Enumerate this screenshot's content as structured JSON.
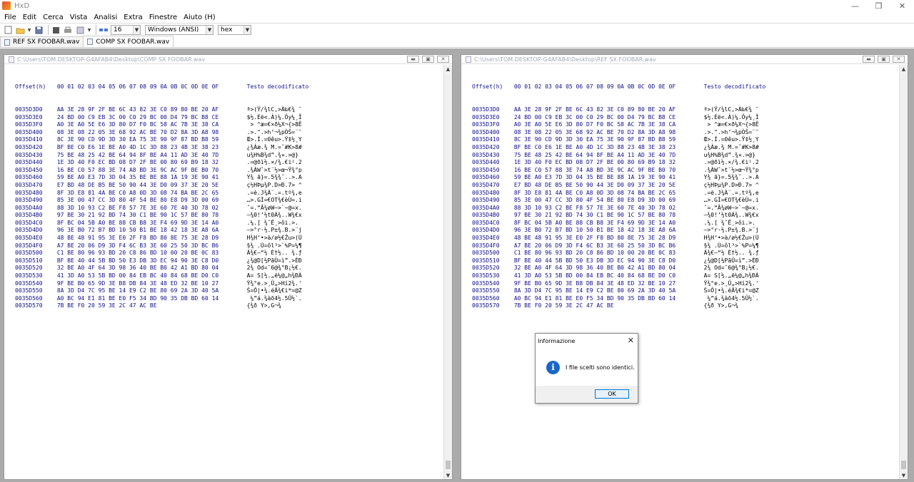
{
  "app": {
    "title": "HxD"
  },
  "window_controls": {
    "minimize": "—",
    "restore": "❐",
    "close": "✕"
  },
  "menu": [
    "File",
    "Edit",
    "Cerca",
    "Vista",
    "Analisi",
    "Extra",
    "Finestre",
    "Aiuto (H)"
  ],
  "toolbar": {
    "bytes_per_row": "16",
    "charset": "Windows (ANSI)",
    "offset_base": "hex"
  },
  "tabs": [
    {
      "label": "REF SX FOOBAR.wav",
      "active": false
    },
    {
      "label": "COMP SX FOOBAR.wav",
      "active": true
    }
  ],
  "panels": [
    {
      "title": "C:\\Users\\TOM.DESKTOP-G4AFAB4\\Desktop\\COMP SX FOOBAR.wav"
    },
    {
      "title": "C:\\Users\\TOM.DESKTOP-G4AFAB4\\Desktop\\REF SX FOOBAR.wav"
    }
  ],
  "hex_header": {
    "offset": "Offset(h)",
    "columns": "00 01 02 03 04 05 06 07 08 09 0A 0B 0C 0D 0E 0F",
    "text": "Testo decodificato"
  },
  "hex_rows": [
    {
      "offset": "0035D3D0",
      "bytes": "AA 3E 28 9F 2F BE 6C 43 82 3E C0 89 80 BE 20 AF",
      "text": "ª>(Ÿ/¾lC‚>À‰€¾ ¯"
    },
    {
      "offset": "0035D3E0",
      "bytes": "24 BD 00 C9 EB 3C 00 C0 29 BC 00 D4 79 BC B8 CE",
      "text": "$½.Éë<.À)¼.Ôy¼¸Î"
    },
    {
      "offset": "0035D3F0",
      "bytes": "A0 3E A0 5E E6 3D 80 D7 F0 BC 58 AC 7B 3E 38 CA",
      "text": " > ^æ=€×ð¼X¬{>8Ê"
    },
    {
      "offset": "0035D400",
      "bytes": "08 3E 08 22 05 3E 68 92 AC BE 70 D2 8A 3D A8 98",
      "text": ".>.\".>h’¬¾pÒŠ=¨˜"
    },
    {
      "offset": "0035D410",
      "bytes": "8C 3E 90 CD 9D 3D 30 EA 75 3E 90 9F 87 BD B8 59",
      "text": "Œ>.Í.=0êu>.Ÿ‡½¸Y"
    },
    {
      "offset": "0035D420",
      "bytes": "BF BE C0 E6 1E BE A0 4D 1C 3D 88 23 4B 3E 38 23",
      "text": "¿¾Àæ.¾ M.=ˆ#K>8#"
    },
    {
      "offset": "0035D430",
      "bytes": "75 BE 48 25 42 BE 64 94 8F BE A4 11 AD 3E 40 7D",
      "text": "u¾H%B¾d”.¾¤.­>@}"
    },
    {
      "offset": "0035D440",
      "bytes": "1E 3D 40 F0 EC BD 08 D7 2F BE 00 80 69 B9 18 32",
      "text": ".=@ðì½.×/¾.€i¹.2"
    },
    {
      "offset": "0035D450",
      "bytes": "16 BE C0 57 88 3E 74 A8 BD 3E 9C AC 9F BE B0 70",
      "text": ".¾ÀWˆ>t¨½>œ¬Ÿ¾°p"
    },
    {
      "offset": "0035D460",
      "bytes": "59 BE A0 E3 7D 3D 04 35 BE BE 88 1A 19 3E 90 41",
      "text": "Y¾ ã}=.5¾¾ˆ..>.A"
    },
    {
      "offset": "0035D470",
      "bytes": "E7 BD 48 DE B5 BE 50 90 44 3E D0 09 37 3E 20 5E",
      "text": "ç½HÞµ¾P.D>Ð.7> ^"
    },
    {
      "offset": "0035D480",
      "bytes": "8F 3D E8 81 4A BE C0 A8 0D 3D 08 74 BA BE 2C 65",
      "text": ".=è.J¾À¨.=.tº¾,e"
    },
    {
      "offset": "0035D490",
      "bytes": "85 3E 00 47 CC 3D 80 4F 54 BE 80 E8 D9 3D 00 69",
      "text": "…>.GÌ=€OT¾€èÙ=.i"
    },
    {
      "offset": "0035D4A0",
      "bytes": "88 3D 10 93 C2 BE F8 57 7E 3E 60 7E 40 3D 78 02",
      "text": "ˆ=.“Â¾øW~>`~@=x."
    },
    {
      "offset": "0035D4B0",
      "bytes": "97 BE 30 21 92 BD 74 30 C1 BE 90 1C 57 BE 80 78",
      "text": "—¾0!’½t0Á¾..W¾€x"
    },
    {
      "offset": "0035D4C0",
      "bytes": "8F BC 04 5B A0 BE 88 CB B8 3E F4 69 9D 3E 14 A0",
      "text": ".¼.[ ¾ˆË¸>ôi.>. "
    },
    {
      "offset": "0035D4D0",
      "bytes": "96 3E B0 72 B7 BD 10 50 B1 BE 18 42 18 3E A8 6A",
      "text": "–>°r·½.P±¾.B.>¨j"
    },
    {
      "offset": "0035D4E0",
      "bytes": "48 BE 48 91 95 3E E0 2F F8 BD 80 8E 75 3E 28 D9",
      "text": "H¾H‘•>à/ø½€Žu>(Ù"
    },
    {
      "offset": "0035D4F0",
      "bytes": "A7 BE 20 06 D9 3D F4 6C B3 3E 60 25 50 3D BC B6",
      "text": "§¾ .Ù=ôl³>`%P=¼¶"
    },
    {
      "offset": "0035D500",
      "bytes": "C1 BE 80 96 93 BD 20 C8 86 BD 10 00 20 BE 0C 83",
      "text": "Á¾€–“½ È†½.. ¾.ƒ"
    },
    {
      "offset": "0035D510",
      "bytes": "BF BE 40 44 5B BD 50 E3 DB 3D EC 94 90 3E C8 D0",
      "text": "¿¾@D[½PãÛ=ì”.>ÈÐ"
    },
    {
      "offset": "0035D520",
      "bytes": "32 BE A0 4F 64 3D 98 36 40 BE B0 42 A1 BD 80 04",
      "text": "2¾ Od=˜6@¾°B¡½€."
    },
    {
      "offset": "0035D530",
      "bytes": "41 3D A0 53 5B BD 00 84 EB BC 40 84 68 BE D0 C0",
      "text": "A= S[½.„ë¼@„h¾ÐÀ"
    },
    {
      "offset": "0035D540",
      "bytes": "9F BE B0 65 9D 3E B8 DB 84 3E 48 ED 32 BE 10 27",
      "text": "Ÿ¾°e.>¸Û„>Hí2¾.'"
    },
    {
      "offset": "0035D550",
      "bytes": "8A 3D D4 7C 95 BE 14 E9 C2 BE 80 69 2A 3D 40 5A",
      "text": "Š=Ô|•¾.éÂ¾€i*=@Z"
    },
    {
      "offset": "0035D560",
      "bytes": "A0 BC 94 E1 81 BE E0 F5 34 BD 90 35 DB BD 60 14",
      "text": " ¼”á.¾àõ4½.5Û½`."
    },
    {
      "offset": "0035D570",
      "bytes": "7B BE F0 20 59 3E 2C 47 AC BE",
      "text": "{¾ð Y>,G¬¾"
    }
  ],
  "dialog": {
    "title": "Informazione",
    "message": "I file scelti sono identici.",
    "ok_label": "OK",
    "icon": "info-icon",
    "close": "✕"
  }
}
